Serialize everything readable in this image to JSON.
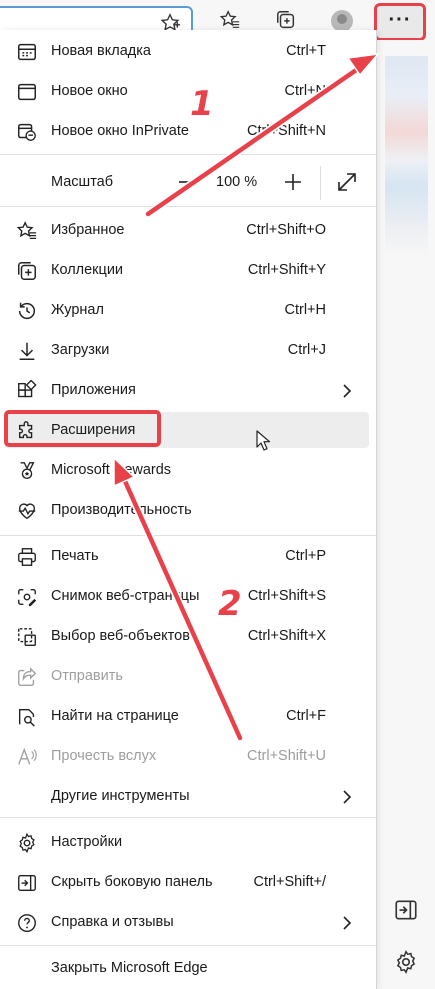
{
  "toolbar": {
    "more_button_label": "···"
  },
  "zoom": {
    "label": "Масштаб",
    "value": "100 %"
  },
  "menu": {
    "new_tab": {
      "label": "Новая вкладка",
      "shortcut": "Ctrl+T"
    },
    "new_window": {
      "label": "Новое окно",
      "shortcut": "Ctrl+N"
    },
    "new_inprivate": {
      "label": "Новое окно InPrivate",
      "shortcut": "Ctrl+Shift+N"
    },
    "favorites": {
      "label": "Избранное",
      "shortcut": "Ctrl+Shift+O"
    },
    "collections": {
      "label": "Коллекции",
      "shortcut": "Ctrl+Shift+Y"
    },
    "history": {
      "label": "Журнал",
      "shortcut": "Ctrl+H"
    },
    "downloads": {
      "label": "Загрузки",
      "shortcut": "Ctrl+J"
    },
    "apps": {
      "label": "Приложения"
    },
    "extensions": {
      "label": "Расширения"
    },
    "rewards": {
      "label": "Microsoft Rewards"
    },
    "performance": {
      "label": "Производительность"
    },
    "print": {
      "label": "Печать",
      "shortcut": "Ctrl+P"
    },
    "screenshot": {
      "label": "Снимок веб-страницы",
      "shortcut": "Ctrl+Shift+S"
    },
    "web_select": {
      "label": "Выбор веб-объектов",
      "shortcut": "Ctrl+Shift+X"
    },
    "share": {
      "label": "Отправить"
    },
    "find": {
      "label": "Найти на странице",
      "shortcut": "Ctrl+F"
    },
    "read_aloud": {
      "label": "Прочесть вслух",
      "shortcut": "Ctrl+Shift+U"
    },
    "more_tools": {
      "label": "Другие инструменты"
    },
    "settings": {
      "label": "Настройки"
    },
    "hide_sidebar": {
      "label": "Скрыть боковую панель",
      "shortcut": "Ctrl+Shift+/"
    },
    "help": {
      "label": "Справка и отзывы"
    },
    "close_edge": {
      "label": "Закрыть Microsoft Edge"
    }
  },
  "annotations": {
    "step1": "1",
    "step2": "2",
    "color": "#e8414a"
  },
  "icons": {
    "new_tab": "new-tab-icon",
    "new_window": "window-icon",
    "inprivate": "inprivate-icon",
    "favorites": "star-list-icon",
    "collections": "collections-icon",
    "history": "history-icon",
    "downloads": "download-icon",
    "apps": "apps-icon",
    "extensions": "puzzle-icon",
    "rewards": "medal-icon",
    "performance": "heartbeat-icon",
    "print": "printer-icon",
    "screenshot": "screenshot-icon",
    "web_select": "web-select-icon",
    "share": "share-icon",
    "find": "find-icon",
    "read_aloud": "read-aloud-icon",
    "settings": "gear-icon",
    "hide_sidebar": "hide-sidebar-icon",
    "help": "help-icon"
  }
}
